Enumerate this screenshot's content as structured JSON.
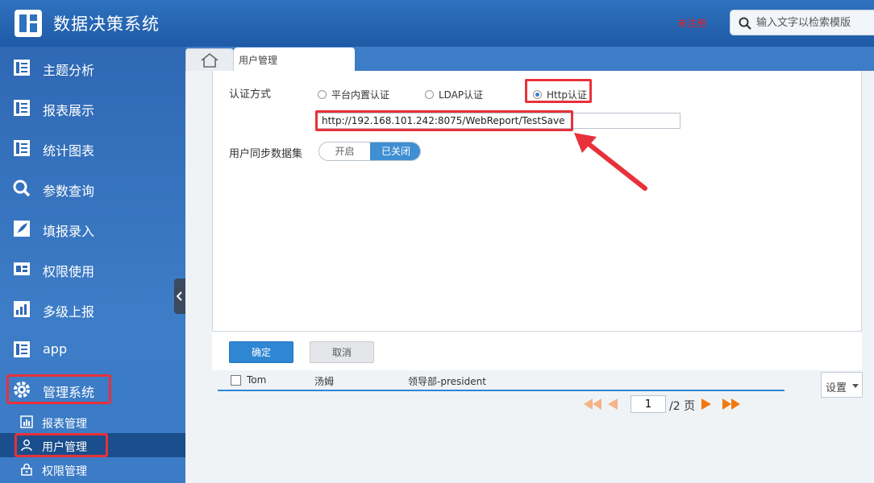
{
  "app": {
    "title": "数据决策系统",
    "unregistered": "未注册"
  },
  "search": {
    "placeholder": "输入文字以检索模版"
  },
  "sidebar": {
    "items": [
      {
        "label": "主题分析",
        "icon": "report-icon"
      },
      {
        "label": "报表展示",
        "icon": "report-icon"
      },
      {
        "label": "统计图表",
        "icon": "report-icon"
      },
      {
        "label": "参数查询",
        "icon": "magnifier-icon"
      },
      {
        "label": "填报录入",
        "icon": "feather-icon"
      },
      {
        "label": "权限使用",
        "icon": "window-icon"
      },
      {
        "label": "多级上报",
        "icon": "bar-chart-icon"
      },
      {
        "label": "app",
        "icon": "report-icon"
      },
      {
        "label": "管理系统",
        "icon": "gear-icon"
      }
    ],
    "subitems": [
      {
        "label": "报表管理",
        "icon": "chart-icon"
      },
      {
        "label": "用户管理",
        "icon": "user-icon"
      },
      {
        "label": "权限管理",
        "icon": "lock-icon"
      }
    ]
  },
  "tabs": {
    "active": "用户管理"
  },
  "form": {
    "auth_label": "认证方式",
    "radio_builtin": "平台内置认证",
    "radio_ldap": "LDAP认证",
    "radio_http": "Http认证",
    "url_value": "http://192.168.101.242:8075/WebReport/TestSave",
    "sync_label": "用户同步数据集",
    "toggle_on": "开启",
    "toggle_off": "已关闭",
    "ok": "确定",
    "cancel": "取消"
  },
  "table": {
    "row": {
      "username": "Tom",
      "realname": "汤姆",
      "dept": "领导部-president"
    }
  },
  "settings": {
    "label": "设置"
  },
  "pager": {
    "current": "1",
    "total": "/2 页"
  },
  "colors": {
    "header": "#1f5aa6",
    "accent": "#2f86d3",
    "highlight": "#e8313a"
  }
}
